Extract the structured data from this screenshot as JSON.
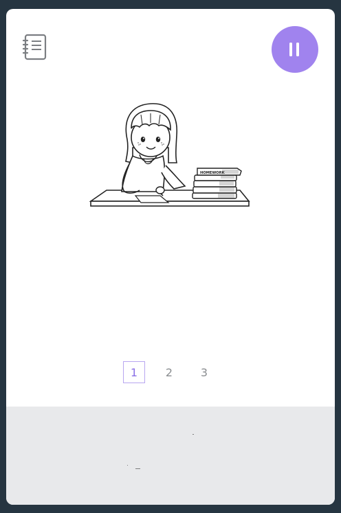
{
  "toolbar": {
    "notes_icon": "notebook-icon",
    "pause_icon": "pause-icon",
    "pause_color": "#a083ee"
  },
  "illustration": {
    "book_label": "HOMEWORK"
  },
  "pagination": {
    "pages": [
      "1",
      "2",
      "3"
    ],
    "current": "1",
    "accent": "#8a6fe6"
  },
  "footer": {
    "background": "#e8e9eb"
  }
}
